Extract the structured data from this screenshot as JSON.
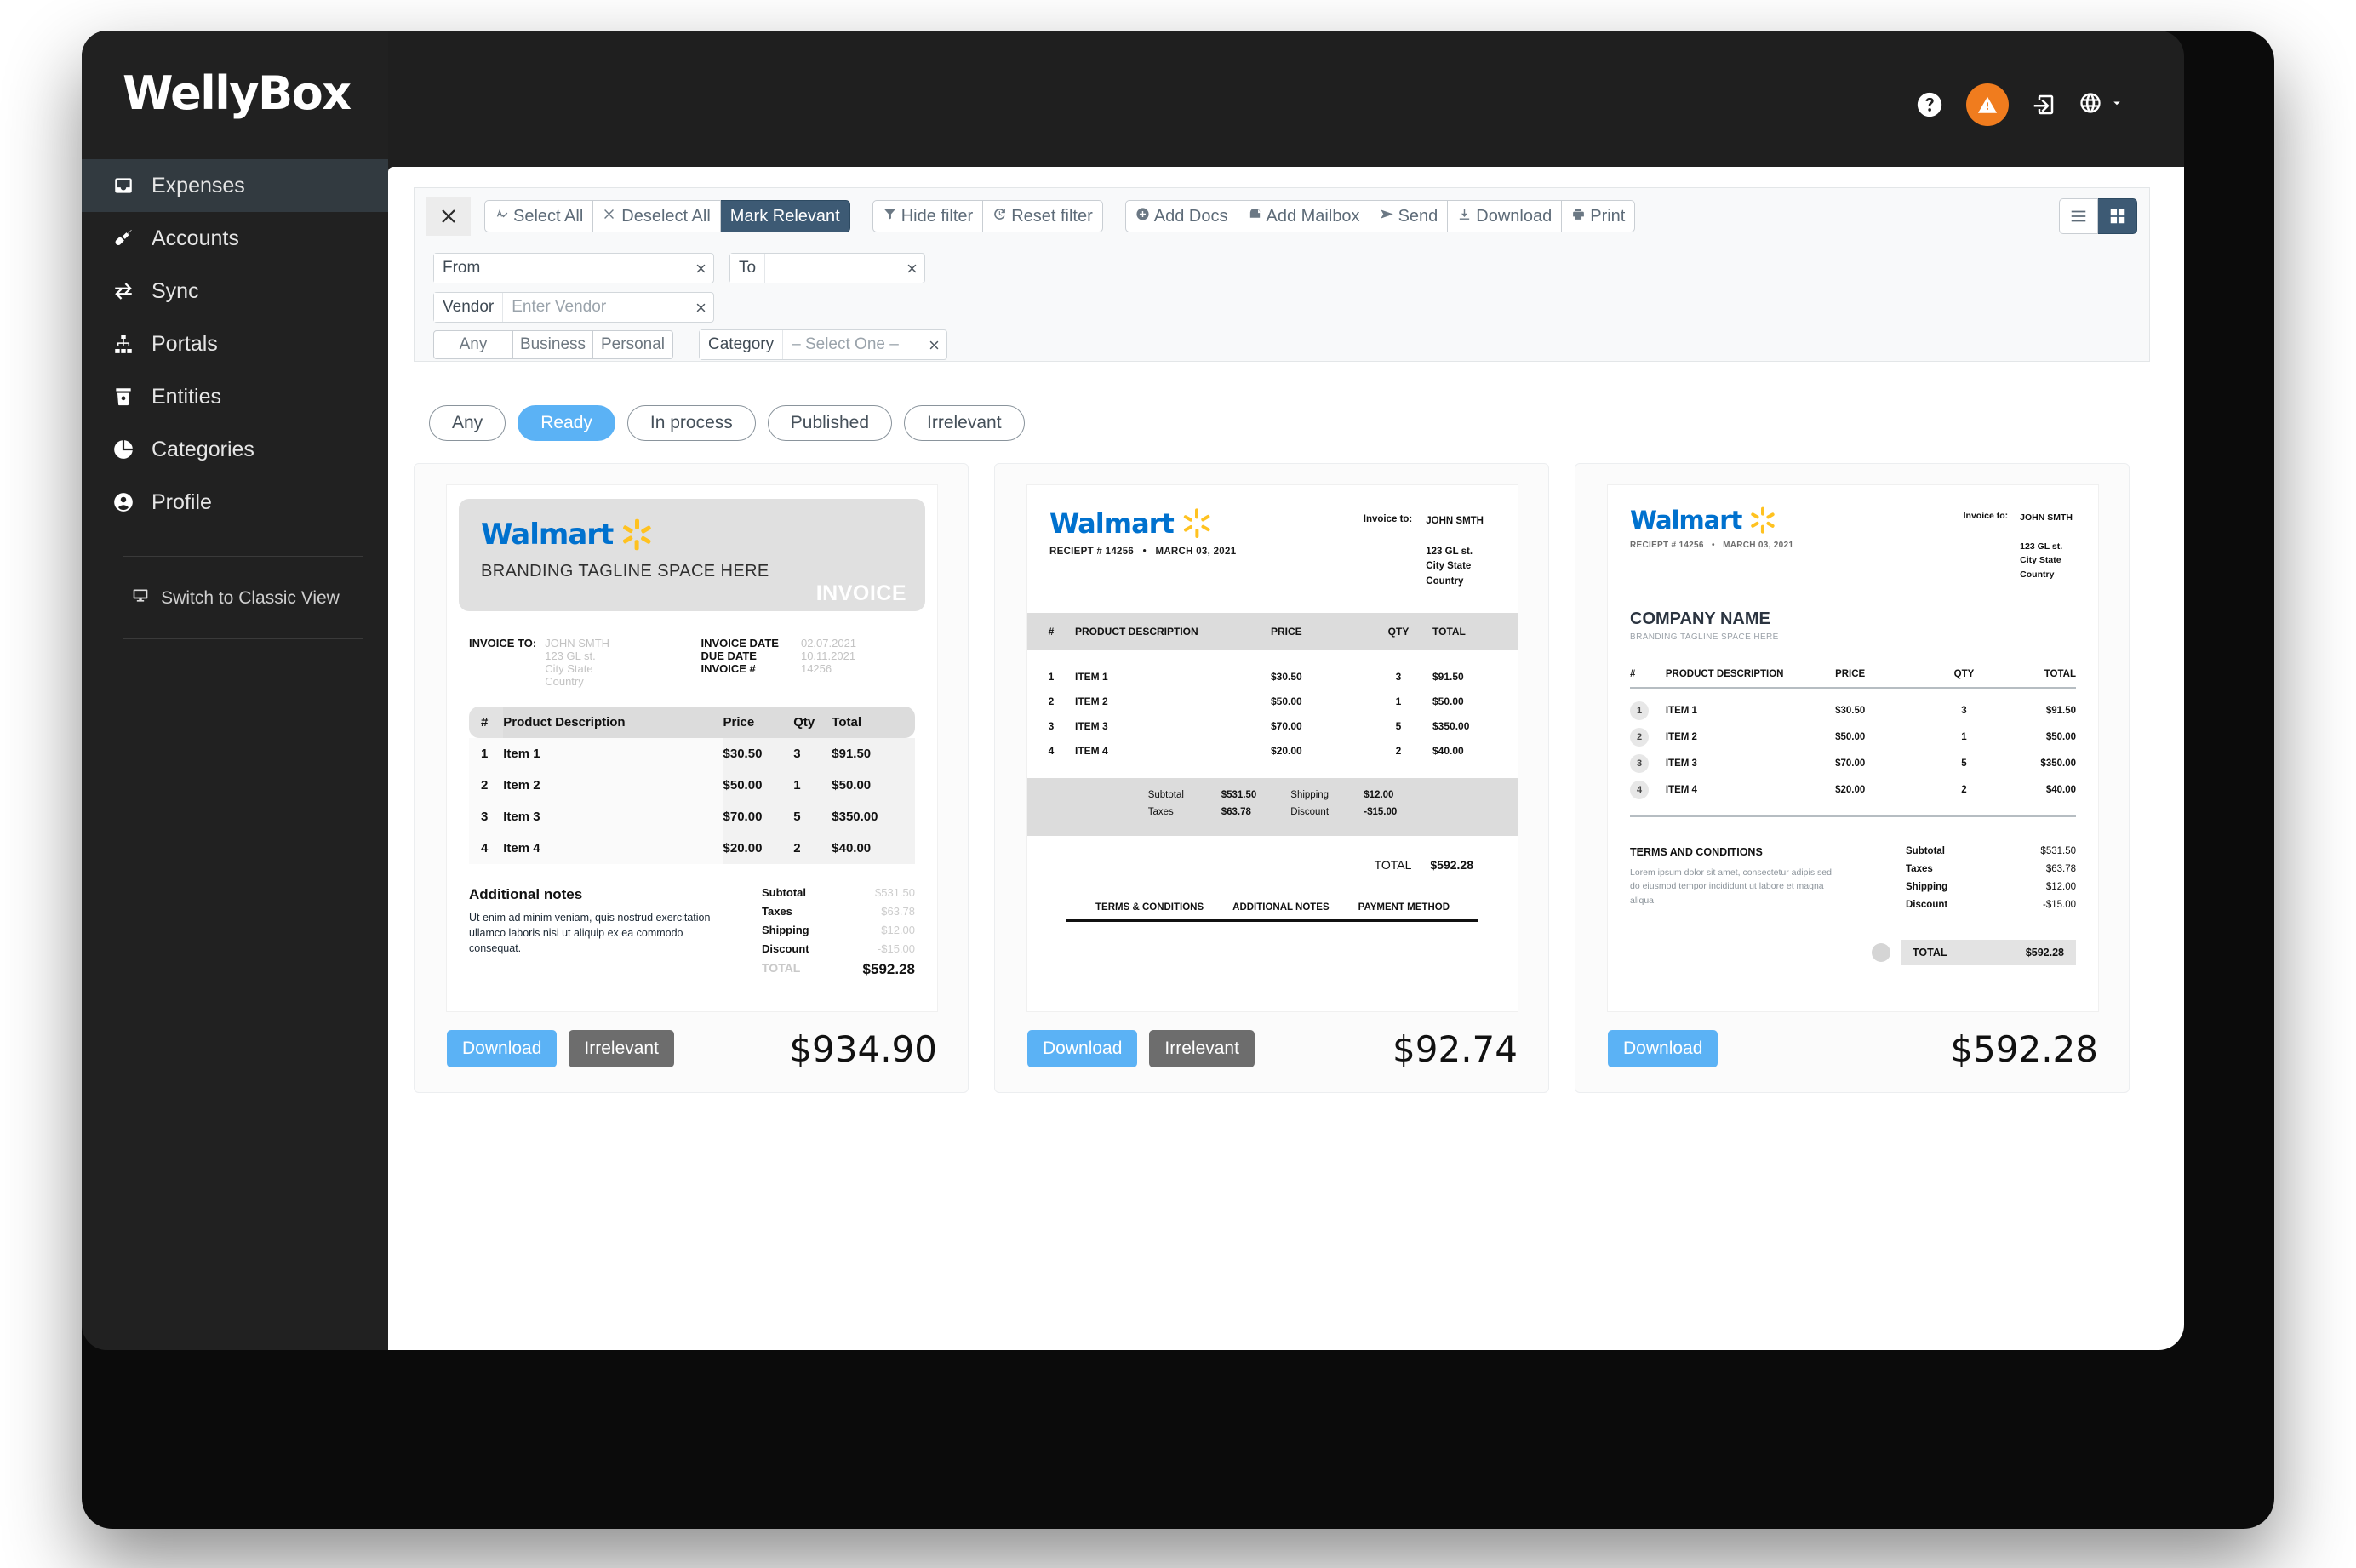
{
  "brand": {
    "name": "WellyBox"
  },
  "sidebar": {
    "items": [
      {
        "label": "Expenses",
        "icon": "inbox-icon",
        "active": true
      },
      {
        "label": "Accounts",
        "icon": "plug-icon",
        "active": false
      },
      {
        "label": "Sync",
        "icon": "sync-icon",
        "active": false
      },
      {
        "label": "Portals",
        "icon": "sitemap-icon",
        "active": false
      },
      {
        "label": "Entities",
        "icon": "entities-icon",
        "active": false
      },
      {
        "label": "Categories",
        "icon": "pie-chart-icon",
        "active": false
      },
      {
        "label": "Profile",
        "icon": "user-circle-icon",
        "active": false
      }
    ],
    "switch_view": "Switch to Classic View"
  },
  "header": {
    "help_icon": "question-circle-icon",
    "alert_icon": "warning-triangle-icon",
    "logout_icon": "sign-out-icon",
    "globe_icon": "globe-icon",
    "chevron_icon": "chevron-down-icon"
  },
  "toolbar": {
    "close_label": "close-icon",
    "select_all": "Select All",
    "deselect_all": "Deselect All",
    "mark_relevant": "Mark Relevant",
    "hide_filter": "Hide filter",
    "reset_filter": "Reset filter",
    "add_docs": "Add Docs",
    "add_mailbox": "Add Mailbox",
    "send": "Send",
    "download": "Download",
    "print": "Print",
    "view_list": "list-view-icon",
    "view_grid": "grid-view-icon",
    "view_selected": "grid"
  },
  "filters": {
    "from_label": "From",
    "from_value": "",
    "to_label": "To",
    "to_value": "",
    "vendor_label": "Vendor",
    "vendor_placeholder": "Enter Vendor",
    "segments": [
      "Any",
      "Business",
      "Personal"
    ],
    "category_label": "Category",
    "category_value": "– Select One –"
  },
  "status_pills": [
    {
      "label": "Any",
      "selected": false
    },
    {
      "label": "Ready",
      "selected": true
    },
    {
      "label": "In process",
      "selected": false
    },
    {
      "label": "Published",
      "selected": false
    },
    {
      "label": "Irrelevant",
      "selected": false
    }
  ],
  "colors": {
    "accent_blue": "#5bb2f5",
    "toolbar_active": "#3d5a74",
    "walmart_blue": "#0071ce",
    "walmart_yellow": "#ffc220",
    "alert_orange": "#f07c1e"
  },
  "card_actions": {
    "download": "Download",
    "irrelevant": "Irrelevant"
  },
  "cards": [
    {
      "amount": "$934.90",
      "variant": "A",
      "vendor": "Walmart",
      "tagline": "BRANDING TAGLINE SPACE HERE",
      "doc_type": "INVOICE",
      "invoice_to_label": "INVOICE TO:",
      "bill_to": [
        "JOHN SMTH",
        "123 GL st.",
        "City   State",
        "Country"
      ],
      "meta": [
        {
          "label": "INVOICE DATE",
          "value": "02.07.2021"
        },
        {
          "label": "DUE DATE",
          "value": "10.11.2021"
        },
        {
          "label": "INVOICE #",
          "value": "14256"
        }
      ],
      "table_headers": [
        "#",
        "Product Description",
        "Price",
        "Qty",
        "Total"
      ],
      "rows": [
        [
          "1",
          "Item 1",
          "$30.50",
          "3",
          "$91.50"
        ],
        [
          "2",
          "Item 2",
          "$50.00",
          "1",
          "$50.00"
        ],
        [
          "3",
          "Item 3",
          "$70.00",
          "5",
          "$350.00"
        ],
        [
          "4",
          "Item 4",
          "$20.00",
          "2",
          "$40.00"
        ]
      ],
      "notes_title": "Additional notes",
      "notes_body": "Ut enim ad minim veniam, quis nostrud exercitation ullamco laboris nisi ut aliquip ex ea commodo consequat.",
      "sums": [
        {
          "label": "Subtotal",
          "value": "$531.50"
        },
        {
          "label": "Taxes",
          "value": "$63.78"
        },
        {
          "label": "Shipping",
          "value": "$12.00"
        },
        {
          "label": "Discount",
          "value": "-$15.00"
        }
      ],
      "total_label": "TOTAL",
      "total_value": "$592.28",
      "show_irrelevant": true
    },
    {
      "amount": "$92.74",
      "variant": "B",
      "vendor": "Walmart",
      "receipt_no": "RECIEPT # 14256",
      "receipt_dot": "•",
      "receipt_date": "MARCH 03, 2021",
      "invoice_to_label": "Invoice to:",
      "bill_to": [
        "JOHN SMTH",
        "123 GL st.",
        "City   State",
        "Country"
      ],
      "table_headers": [
        "#",
        "PRODUCT DESCRIPTION",
        "PRICE",
        "QTY",
        "TOTAL"
      ],
      "rows": [
        [
          "1",
          "ITEM 1",
          "$30.50",
          "3",
          "$91.50"
        ],
        [
          "2",
          "ITEM 2",
          "$50.00",
          "1",
          "$50.00"
        ],
        [
          "3",
          "ITEM 3",
          "$70.00",
          "5",
          "$350.00"
        ],
        [
          "4",
          "ITEM 4",
          "$20.00",
          "2",
          "$40.00"
        ]
      ],
      "sums_left": [
        {
          "label": "Subtotal",
          "value": "$531.50"
        },
        {
          "label": "Taxes",
          "value": "$63.78"
        }
      ],
      "sums_right": [
        {
          "label": "Shipping",
          "value": "$12.00"
        },
        {
          "label": "Discount",
          "value": "-$15.00"
        }
      ],
      "total_label": "TOTAL",
      "total_value": "$592.28",
      "tabs": [
        "TERMS & CONDITIONS",
        "ADDITIONAL NOTES",
        "PAYMENT METHOD"
      ],
      "show_irrelevant": true
    },
    {
      "amount": "$592.28",
      "variant": "C",
      "vendor": "Walmart",
      "receipt_no": "RECIEPT # 14256",
      "receipt_dot": "•",
      "receipt_date": "MARCH 03, 2021",
      "invoice_to_label": "Invoice to:",
      "bill_to": [
        "JOHN SMTH",
        "123 GL st.",
        "City   State",
        "Country"
      ],
      "company_name": "COMPANY NAME",
      "company_tagline": "BRANDING TAGLINE SPACE HERE",
      "table_headers": [
        "#",
        "PRODUCT DESCRIPTION",
        "PRICE",
        "QTY",
        "TOTAL"
      ],
      "rows": [
        [
          "1",
          "ITEM 1",
          "$30.50",
          "3",
          "$91.50"
        ],
        [
          "2",
          "ITEM 2",
          "$50.00",
          "1",
          "$50.00"
        ],
        [
          "3",
          "ITEM 3",
          "$70.00",
          "5",
          "$350.00"
        ],
        [
          "4",
          "ITEM 4",
          "$20.00",
          "2",
          "$40.00"
        ]
      ],
      "terms_title": "TERMS AND CONDITIONS",
      "terms_body": "Lorem ipsum dolor sit amet, consectetur adipis sed do eiusmod tempor incididunt ut labore et magna aliqua.",
      "sums": [
        {
          "label": "Subtotal",
          "value": "$531.50"
        },
        {
          "label": "Taxes",
          "value": "$63.78"
        },
        {
          "label": "Shipping",
          "value": "$12.00"
        },
        {
          "label": "Discount",
          "value": "-$15.00"
        }
      ],
      "total_label": "TOTAL",
      "total_value": "$592.28",
      "show_irrelevant": false
    }
  ]
}
